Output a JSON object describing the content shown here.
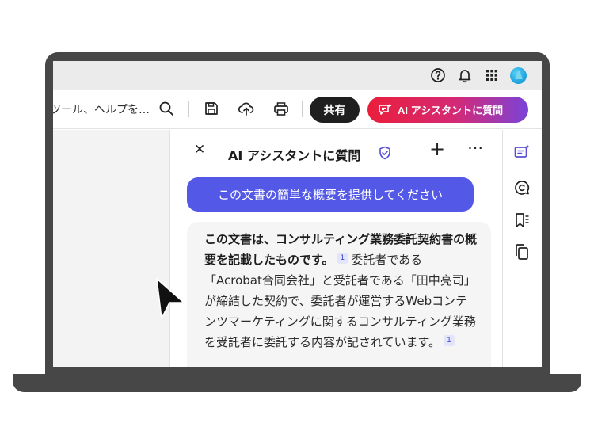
{
  "header": {
    "icons": [
      "help-icon",
      "bell-icon",
      "apps-grid-icon",
      "avatar"
    ]
  },
  "toolbar": {
    "search_text": "ツール、ヘルプを…",
    "share_label": "共有",
    "ai_button_label": "AI アシスタントに質問"
  },
  "ai_panel": {
    "title": "AI アシスタントに質問",
    "user_prompt": "この文書の簡単な概要を提供してください",
    "answer": {
      "bold_lead": "この文書は、コンサルティング業務委託契約書の概要を記載したものです。",
      "citation_1": "1",
      "body": "委託者である「Acrobat合同会社」と受託者である「田中亮司」が締結した契約で、委託者が運営するWebコンテンツマーケティングに関するコンサルティング業務を受託者に委託する内容が記されています。",
      "citation_2": "1"
    }
  },
  "colors": {
    "frame": "#474747",
    "user_bubble": "#5358e6",
    "ai_gradient_start": "#ea1e3b",
    "ai_gradient_end": "#7a43d8",
    "accent_purple": "#5a4fd6"
  }
}
